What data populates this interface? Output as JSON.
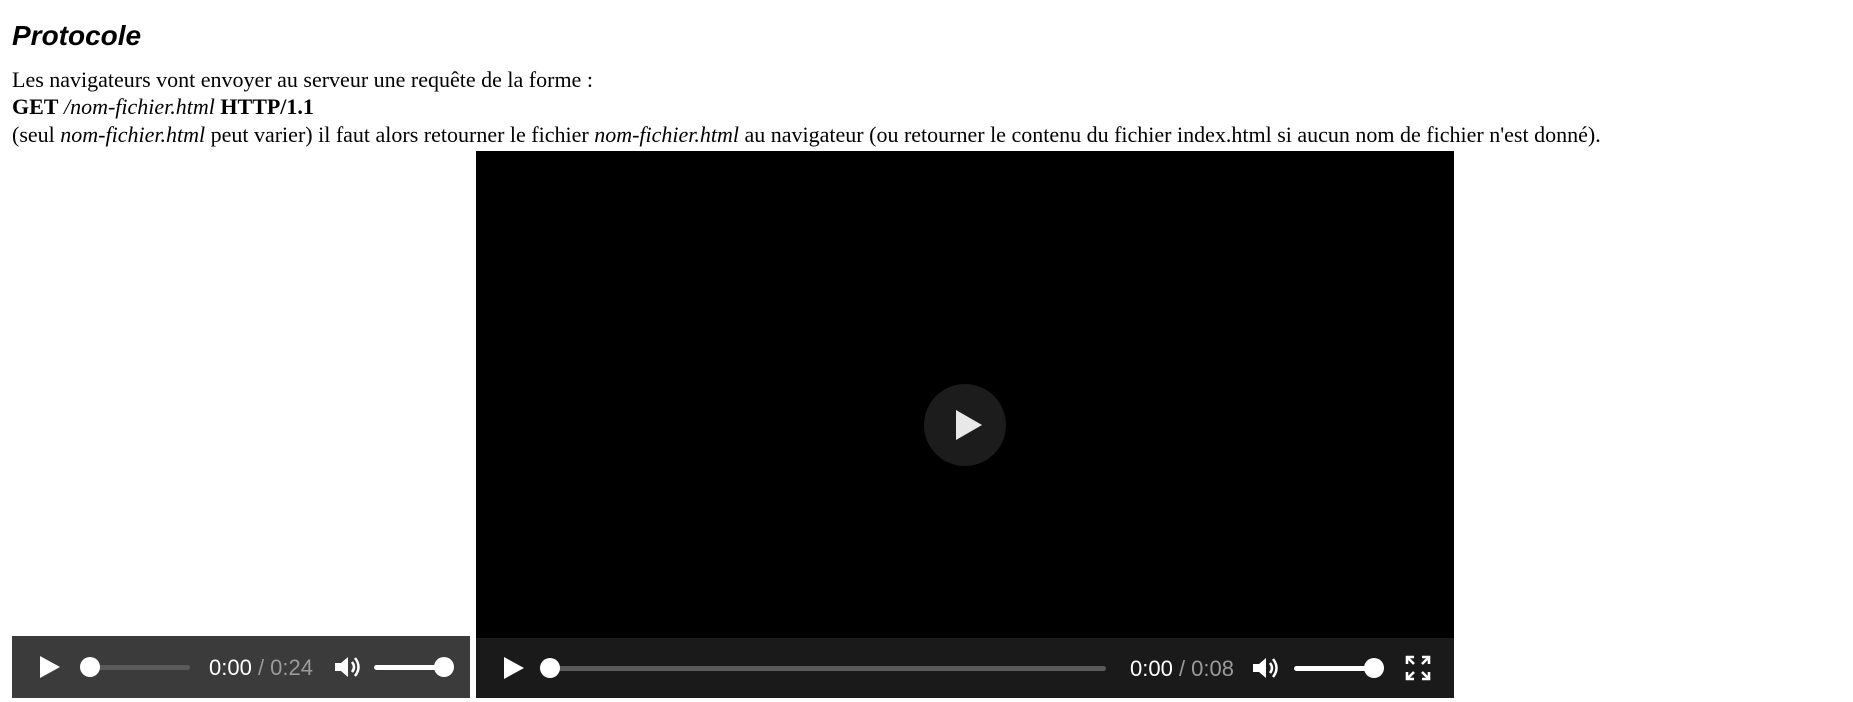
{
  "section": {
    "heading": "Protocole",
    "intro": "Les navigateurs vont envoyer au serveur une requête de la forme :",
    "request": {
      "method": "GET",
      "path": "/nom-fichier.html",
      "version": "HTTP/1.1"
    },
    "note": {
      "p1": "(seul ",
      "em1": "nom-fichier.html",
      "p2": " peut varier) il faut alors retourner le fichier ",
      "em2": "nom-fichier.html",
      "p3": " au navigateur (ou retourner le contenu du fichier index.html si aucun nom de fichier n'est donné)."
    }
  },
  "audio": {
    "current": "0:00",
    "separator": " / ",
    "duration": "0:24",
    "progress": 0,
    "volume": 1
  },
  "video": {
    "current": "0:00",
    "separator": " / ",
    "duration": "0:08",
    "progress": 0,
    "volume": 1
  },
  "icons": {
    "play": "play-icon",
    "volume": "volume-icon",
    "fullscreen": "fullscreen-icon",
    "big_play": "big-play-icon"
  },
  "colors": {
    "audio_bar": "#3b3b3b",
    "video_bar": "#1a1a1a",
    "video_screen": "#000000",
    "control_fg": "#ffffff",
    "duration_text": "#9a9a9a"
  }
}
